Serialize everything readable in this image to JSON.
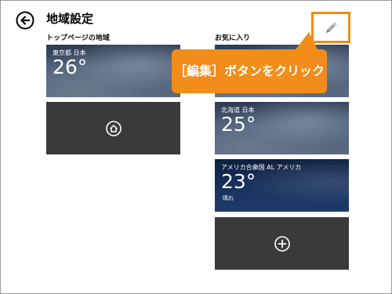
{
  "header": {
    "title": "地域設定",
    "back_icon": "back-arrow-icon"
  },
  "home_section": {
    "label": "トップページの地域",
    "weather_tile": {
      "location": "東京都 日本",
      "temperature": "26°"
    },
    "set_home_icon": "home-location-icon"
  },
  "favorites_section": {
    "label": "お気に入り",
    "tiles": [
      {
        "location": "北海道 日本",
        "temperature": "25°",
        "condition": ""
      },
      {
        "location": "アメリカ合衆国 AL アメリカ",
        "temperature": "23°",
        "condition": "晴れ"
      }
    ],
    "add_icon": "add-icon"
  },
  "edit": {
    "icon": "pencil-edit-icon",
    "highlight_color": "#f28c1a"
  },
  "callout": {
    "text": "［編集］ボタンをクリック",
    "color": "#f28c1a"
  }
}
